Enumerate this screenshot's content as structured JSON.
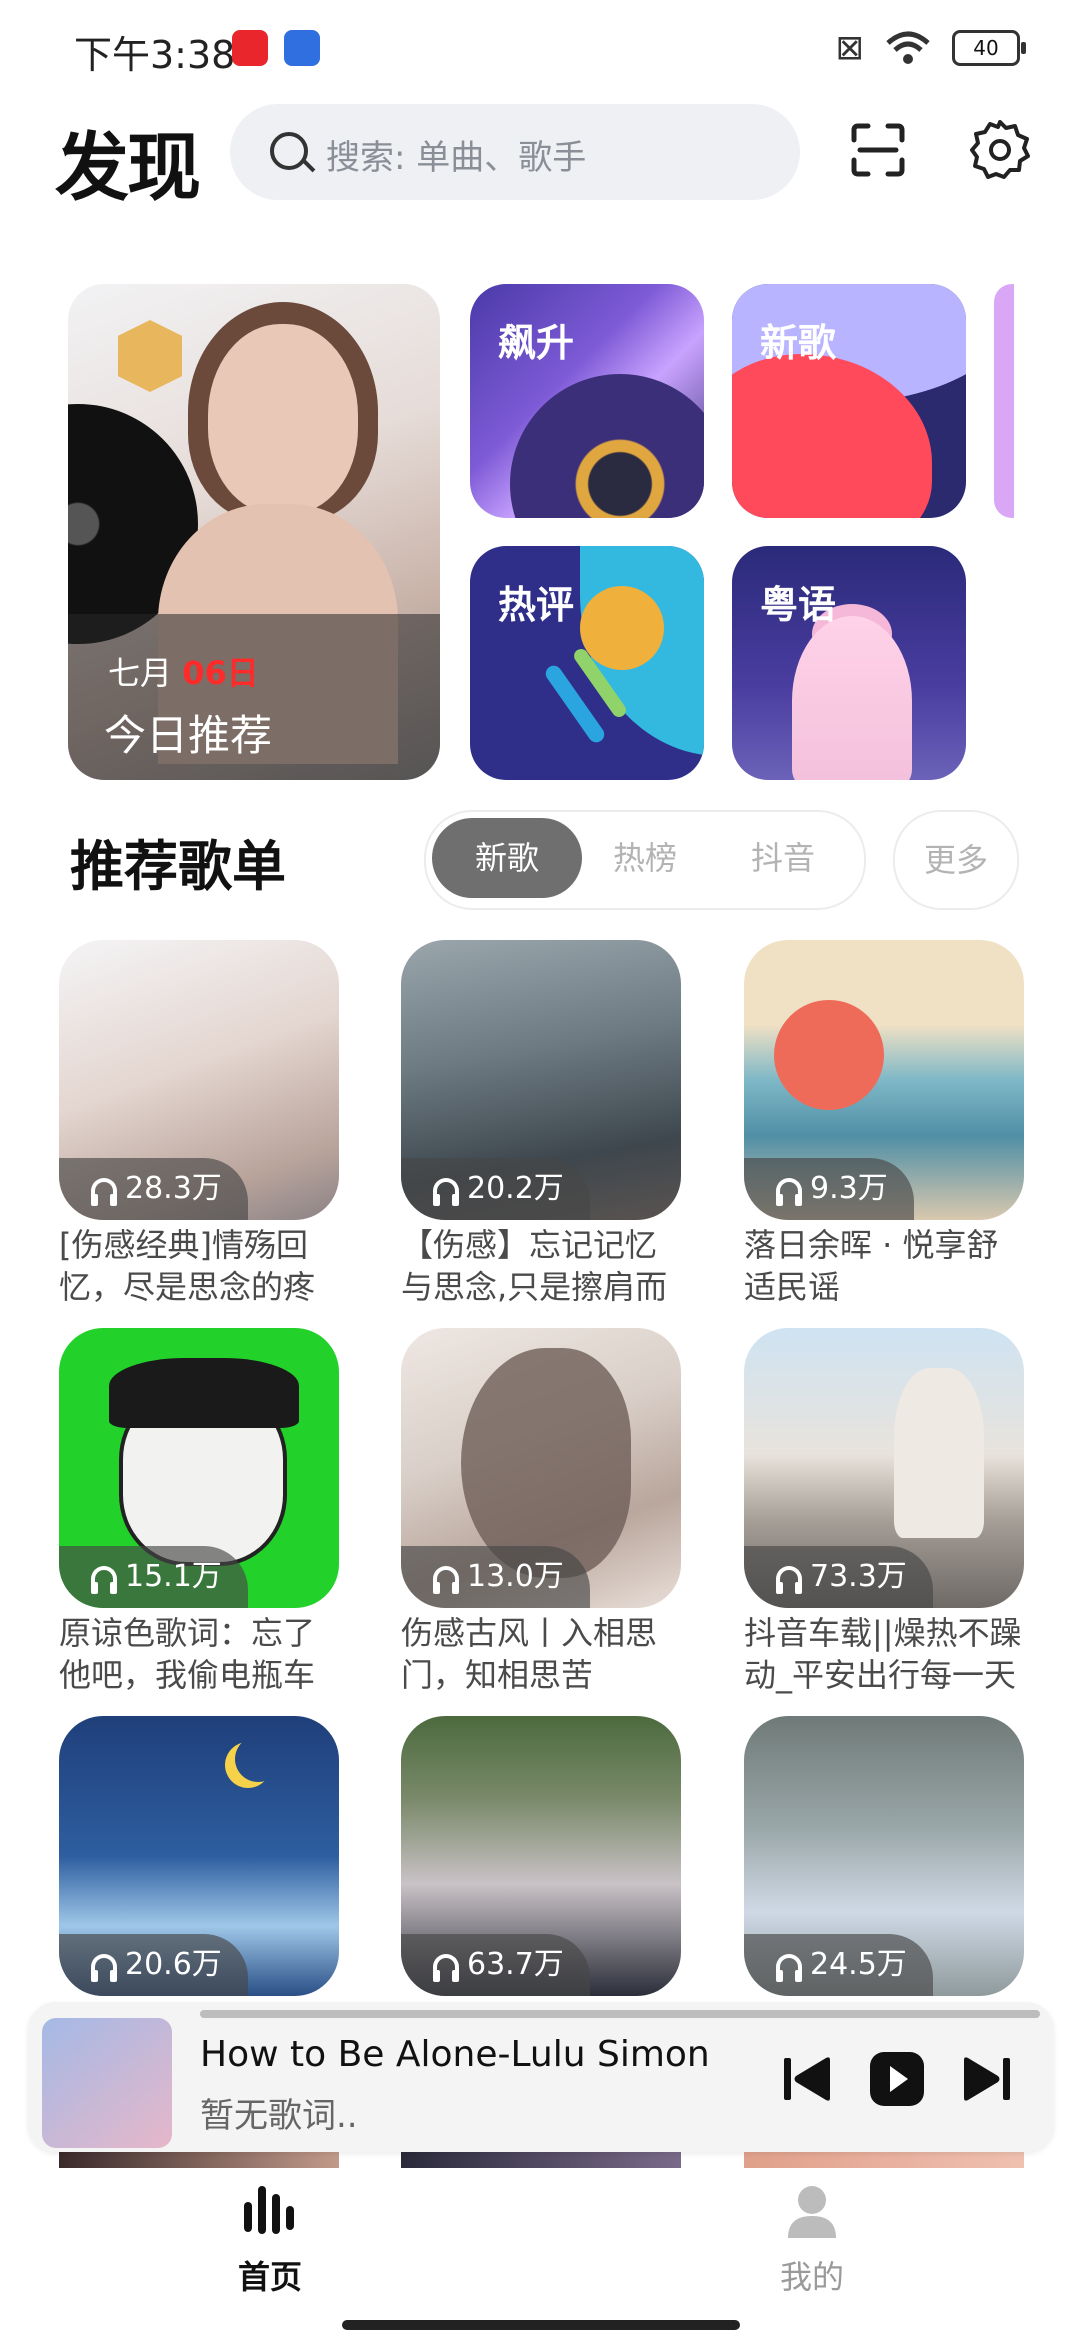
{
  "status_bar": {
    "time": "下午3:38",
    "battery": "40"
  },
  "header": {
    "title": "发现",
    "search_placeholder": "搜索: 单曲、歌手"
  },
  "daily": {
    "month": "七月",
    "day": "06日",
    "label": "今日推荐"
  },
  "features": [
    {
      "label": "飙升"
    },
    {
      "label": "新歌"
    },
    {
      "label": "热评"
    },
    {
      "label": "粤语"
    }
  ],
  "section": {
    "title": "推荐歌单",
    "tabs": [
      "新歌",
      "热榜",
      "抖音"
    ],
    "active_tab": "新歌",
    "more": "更多"
  },
  "playlists": [
    {
      "count": "28.3万",
      "title": "[伤感经典]情殇回忆，尽是思念的疼"
    },
    {
      "count": "20.2万",
      "title": "【伤感】忘记记忆与思念,只是擦肩而"
    },
    {
      "count": "9.3万",
      "title": "落日余晖 · 悦享舒适民谣"
    },
    {
      "count": "15.1万",
      "title": "原谅色歌词：忘了他吧，我偷电瓶车"
    },
    {
      "count": "13.0万",
      "title": "伤感古风丨入相思门，知相思苦"
    },
    {
      "count": "73.3万",
      "title": "抖音车载||燥热不躁动_平安出行每一天"
    },
    {
      "count": "20.6万",
      "title": ""
    },
    {
      "count": "63.7万",
      "title": ""
    },
    {
      "count": "24.5万",
      "title": ""
    }
  ],
  "player": {
    "song": "How to Be Alone-Lulu Simon",
    "lyric": "暂无歌词.."
  },
  "nav": {
    "home": "首页",
    "me": "我的"
  },
  "colors": {
    "active_tab_bg": "#6f6f6f",
    "date_red": "#ff2a2a"
  }
}
